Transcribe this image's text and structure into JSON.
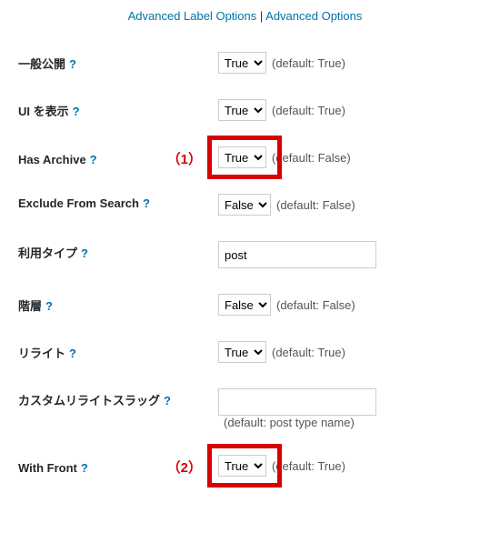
{
  "topLinks": {
    "advancedLabel": "Advanced Label Options",
    "separator": " | ",
    "advanced": "Advanced Options"
  },
  "rows": {
    "public": {
      "label": "一般公開",
      "value": "True",
      "hint": "(default: True)"
    },
    "showUi": {
      "label": "UI を表示",
      "value": "True",
      "hint": "(default: True)"
    },
    "hasArchive": {
      "label": "Has Archive",
      "value": "True",
      "hint": "(default: False)",
      "anno": "（1）"
    },
    "excludeSearch": {
      "label": "Exclude From Search",
      "value": "False",
      "hint": "(default: False)"
    },
    "capType": {
      "label": "利用タイプ",
      "value": "post"
    },
    "hierarchical": {
      "label": "階層",
      "value": "False",
      "hint": "(default: False)"
    },
    "rewrite": {
      "label": "リライト",
      "value": "True",
      "hint": "(default: True)"
    },
    "customSlug": {
      "label": "カスタムリライトスラッグ",
      "value": "",
      "hint": "(default: post type name)"
    },
    "withFront": {
      "label": "With Front",
      "value": "True",
      "hint": "(default: True)",
      "anno": "（2）"
    }
  },
  "helpGlyph": "?"
}
